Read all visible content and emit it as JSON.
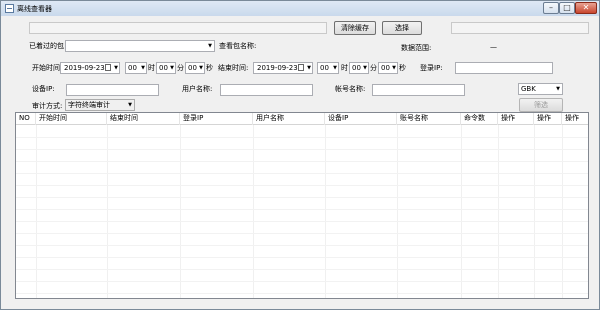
{
  "window": {
    "title": "离线查看器",
    "min": "–",
    "max": "□",
    "close": "✕"
  },
  "toolbar": {
    "clear_cache": "清除缓存",
    "select": "选择"
  },
  "row1": {
    "opened_label": "已着过的包：",
    "package_label": "查看包名称:",
    "range_label": "数据范围:",
    "range_value": "—"
  },
  "row2": {
    "start_label": "开始时间:",
    "start_date": "2019-09-23",
    "start_hour": "00",
    "hour_label": "时",
    "start_min": "00",
    "min_label": "分",
    "start_sec": "00",
    "sec_label": "秒",
    "end_label": "结束时间:",
    "end_date": "2019-09-23",
    "end_hour": "00",
    "end_min": "00",
    "end_sec": "00",
    "login_ip_label": "登录IP:"
  },
  "row3": {
    "device_ip_label": "设备IP:",
    "user_label": "用户名称:",
    "account_label": "帐号名称:",
    "encoding": "GBK"
  },
  "row4": {
    "audit_label": "审计方式:",
    "audit_value": "字符终端审计",
    "filter_button": "筛选"
  },
  "table": {
    "columns": [
      "NO",
      "开始时间",
      "结束时间",
      "登录IP",
      "用户名称",
      "设备IP",
      "账号名称",
      "命令数",
      "操作",
      "操作",
      "操作"
    ]
  }
}
